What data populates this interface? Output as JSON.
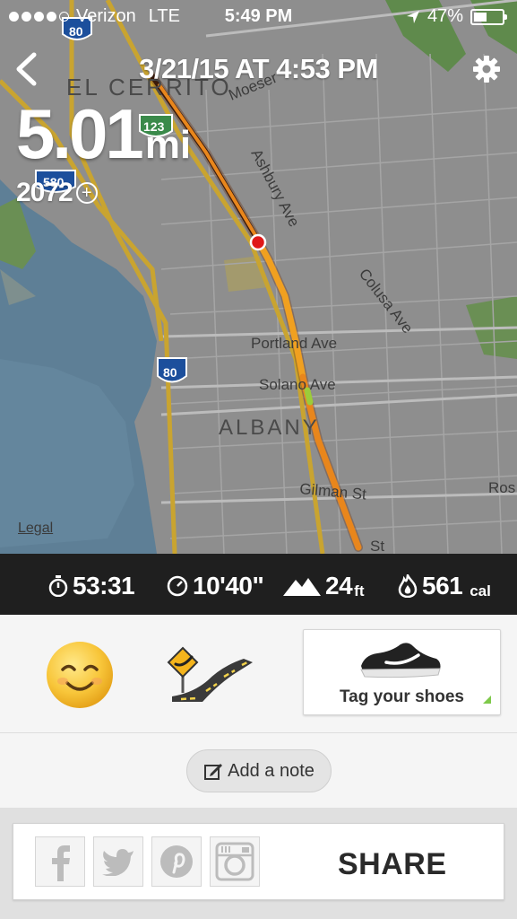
{
  "status_bar": {
    "carrier": "Verizon",
    "network": "LTE",
    "time": "5:49 PM",
    "battery": "47%",
    "battery_level": 0.47,
    "signal_bars_filled": 4,
    "signal_bars_total": 5
  },
  "header": {
    "run_date": "3/21/15 AT 4:53 PM",
    "back_icon": "chevron-left-icon",
    "settings_icon": "gear-icon"
  },
  "summary": {
    "distance": "5.01",
    "distance_unit": "mi",
    "nikefuel": "2072"
  },
  "map": {
    "legal": "Legal",
    "labels": {
      "el_cerrito": "EL CERRITO",
      "albany": "ALBANY",
      "moeser": "Moeser",
      "ashbury": "Ashbury Ave",
      "colusa": "Colusa Ave",
      "portland": "Portland Ave",
      "solano": "Solano Ave",
      "gilman": "Gilman St",
      "st": "St",
      "ros": "Ros",
      "hwy_80_top": "80",
      "hwy_80_mid": "80",
      "hwy_580": "580",
      "hwy_123": "123"
    },
    "colors": {
      "land": "#8e8e8e",
      "water": "#5e7f96",
      "park": "#5f8a4c",
      "highway": "#c9a430",
      "route_hot": "#e8861c",
      "route_cool": "#9ccc3a"
    }
  },
  "stats": {
    "duration": "53:31",
    "pace": "10'40\"",
    "elevation": "24",
    "elevation_unit": "ft",
    "calories": "561",
    "calories_unit": "cal"
  },
  "details": {
    "mood_icon": "smiling-face-icon",
    "terrain_icon": "road-terrain-icon",
    "tag_shoes": "Tag your shoes",
    "add_note": "Add a note"
  },
  "share": {
    "label": "SHARE",
    "facebook_icon": "facebook-icon",
    "twitter_icon": "twitter-icon",
    "pinterest_icon": "pinterest-icon",
    "instagram_icon": "instagram-icon"
  }
}
